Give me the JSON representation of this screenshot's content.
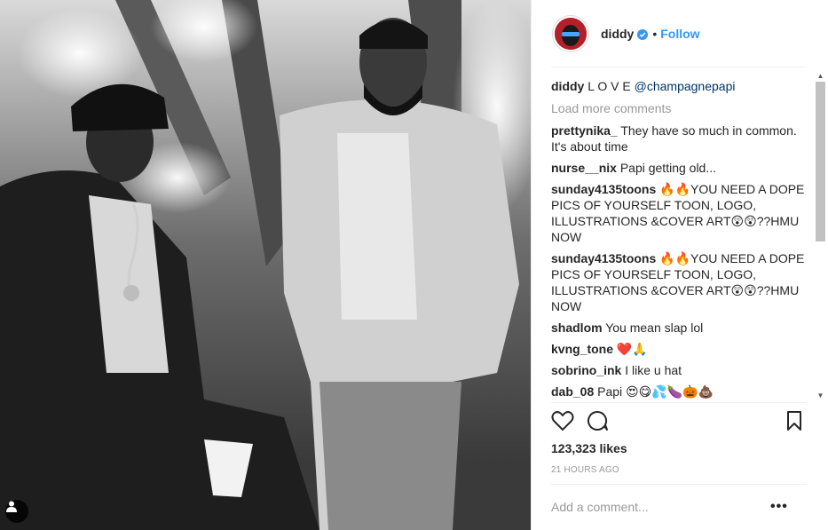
{
  "photo": {
    "description_icon": "user-tag-icon"
  },
  "header": {
    "username": "diddy",
    "dot": "•",
    "follow_label": "Follow",
    "verified_icon": "verified-badge-icon"
  },
  "caption": {
    "user": "diddy",
    "text": "L O V E ",
    "mention": "@champagnepapi"
  },
  "load_more": "Load more comments",
  "comments": [
    {
      "user": "prettynika_",
      "text": "They have so much in common. It's about time"
    },
    {
      "user": "nurse__nix",
      "text": "Papi getting old..."
    },
    {
      "user": "sunday4135toons",
      "text": "🔥🔥YOU NEED A DOPE PICS OF YOURSELF TOON, LOGO, ILLUSTRATIONS &COVER ART😲😲??HMU NOW"
    },
    {
      "user": "sunday4135toons",
      "text": "🔥🔥YOU NEED A DOPE PICS OF YOURSELF TOON, LOGO, ILLUSTRATIONS &COVER ART😲😲??HMU NOW"
    },
    {
      "user": "shadlom",
      "text": "You mean slap lol"
    },
    {
      "user": "kvng_tone",
      "text": "❤️🙏"
    },
    {
      "user": "sobrino_ink",
      "text": "I like u hat"
    },
    {
      "user": "dab_08",
      "text": "Papi 😍😋💦🍆🎃💩"
    }
  ],
  "likes": "123,323 likes",
  "time": "21 HOURS AGO",
  "add_comment": {
    "placeholder": "Add a comment..."
  },
  "more": "•••",
  "colors": {
    "link": "#3897f0",
    "text": "#262626",
    "muted": "#999999"
  }
}
